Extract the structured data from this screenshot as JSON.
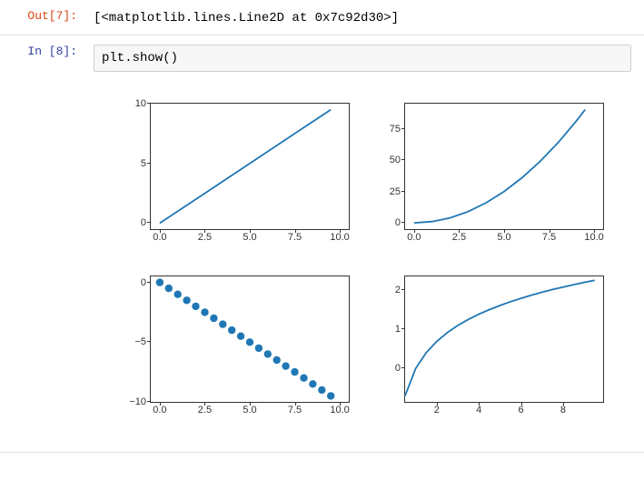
{
  "cells": {
    "out7": {
      "prompt": "Out[7]:",
      "text": "[<matplotlib.lines.Line2D at 0x7c92d30>]"
    },
    "in8": {
      "prompt": "In  [8]:",
      "code": "plt.show()"
    }
  },
  "chart_data": [
    {
      "type": "line",
      "position": "top-left",
      "xlim": [
        -0.5,
        10.5
      ],
      "ylim": [
        -0.5,
        10
      ],
      "xticks": [
        0.0,
        2.5,
        5.0,
        7.5,
        10.0
      ],
      "yticks": [
        0,
        5,
        10
      ],
      "ytick_labels": [
        "0",
        "5",
        "10"
      ],
      "xtick_labels": [
        "0.0",
        "2.5",
        "5.0",
        "7.5",
        "10.0"
      ],
      "x": [
        0,
        2.5,
        5,
        7.5,
        9.5
      ],
      "y": [
        0,
        2.5,
        5,
        7.5,
        9.5
      ]
    },
    {
      "type": "line",
      "position": "top-right",
      "xlim": [
        -0.5,
        10.5
      ],
      "ylim": [
        -5,
        95
      ],
      "xticks": [
        0.0,
        2.5,
        5.0,
        7.5,
        10.0
      ],
      "yticks": [
        0,
        25,
        50,
        75
      ],
      "ytick_labels": [
        "0",
        "25",
        "50",
        "75"
      ],
      "xtick_labels": [
        "0.0",
        "2.5",
        "5.0",
        "7.5",
        "10.0"
      ],
      "x": [
        0,
        1,
        2,
        3,
        4,
        5,
        6,
        7,
        8,
        9,
        9.5
      ],
      "y": [
        0,
        1,
        4,
        9,
        16,
        25,
        36,
        49,
        64,
        81,
        90.25
      ]
    },
    {
      "type": "scatter",
      "position": "bottom-left",
      "xlim": [
        -0.5,
        10.5
      ],
      "ylim": [
        -10,
        0.5
      ],
      "xticks": [
        0.0,
        2.5,
        5.0,
        7.5,
        10.0
      ],
      "yticks": [
        -10,
        -5,
        0
      ],
      "ytick_labels": [
        "−10",
        "−5",
        "0"
      ],
      "xtick_labels": [
        "0.0",
        "2.5",
        "5.0",
        "7.5",
        "10.0"
      ],
      "x": [
        0,
        0.5,
        1,
        1.5,
        2,
        2.5,
        3,
        3.5,
        4,
        4.5,
        5,
        5.5,
        6,
        6.5,
        7,
        7.5,
        8,
        8.5,
        9,
        9.5
      ],
      "y": [
        0,
        -0.5,
        -1,
        -1.5,
        -2,
        -2.5,
        -3,
        -3.5,
        -4,
        -4.5,
        -5,
        -5.5,
        -6,
        -6.5,
        -7,
        -7.5,
        -8,
        -8.5,
        -9,
        -9.5
      ]
    },
    {
      "type": "line",
      "position": "bottom-right",
      "xlim": [
        0.5,
        9.9
      ],
      "ylim": [
        -0.85,
        2.35
      ],
      "xticks": [
        2,
        4,
        6,
        8
      ],
      "yticks": [
        0,
        1,
        2
      ],
      "ytick_labels": [
        "0",
        "1",
        "2"
      ],
      "xtick_labels": [
        "2",
        "4",
        "6",
        "8"
      ],
      "x": [
        0.5,
        1,
        1.5,
        2,
        2.5,
        3,
        3.5,
        4,
        4.5,
        5,
        5.5,
        6,
        6.5,
        7,
        7.5,
        8,
        8.5,
        9,
        9.5
      ],
      "y": [
        -0.693,
        0,
        0.405,
        0.693,
        0.916,
        1.099,
        1.253,
        1.386,
        1.504,
        1.609,
        1.705,
        1.792,
        1.872,
        1.946,
        2.015,
        2.079,
        2.14,
        2.197,
        2.251
      ]
    }
  ]
}
